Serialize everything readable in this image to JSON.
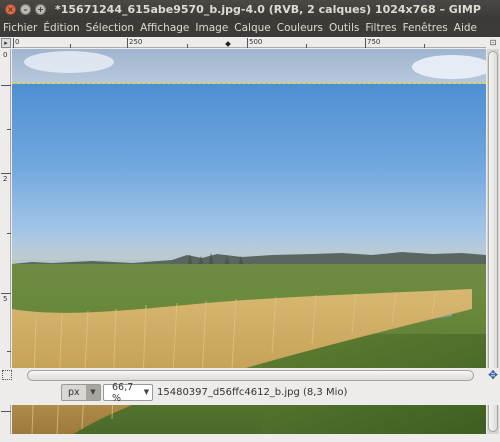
{
  "window": {
    "title": "*15671244_615abe9570_b.jpg-4.0 (RVB, 2 calques) 1024x768 – GIMP",
    "close_glyph": "×",
    "minimize_glyph": "–",
    "maximize_glyph": "+"
  },
  "menubar": {
    "items": [
      "Fichier",
      "Édition",
      "Sélection",
      "Affichage",
      "Image",
      "Calque",
      "Couleurs",
      "Outils",
      "Filtres",
      "Fenêtres",
      "Aide"
    ]
  },
  "rulers": {
    "horizontal_labels": [
      "0",
      "250",
      "500",
      "750"
    ],
    "vertical_labels": [
      "0",
      "2",
      "5"
    ]
  },
  "statusbar": {
    "unit": "px",
    "zoom": "66,7 %",
    "info": "15480397_d56ffc4612_b.jpg (8,3 Mio)"
  },
  "icons": {
    "quick_mask": "quick-mask-icon",
    "navigate": "navigate-icon",
    "dropdown": "▼"
  }
}
